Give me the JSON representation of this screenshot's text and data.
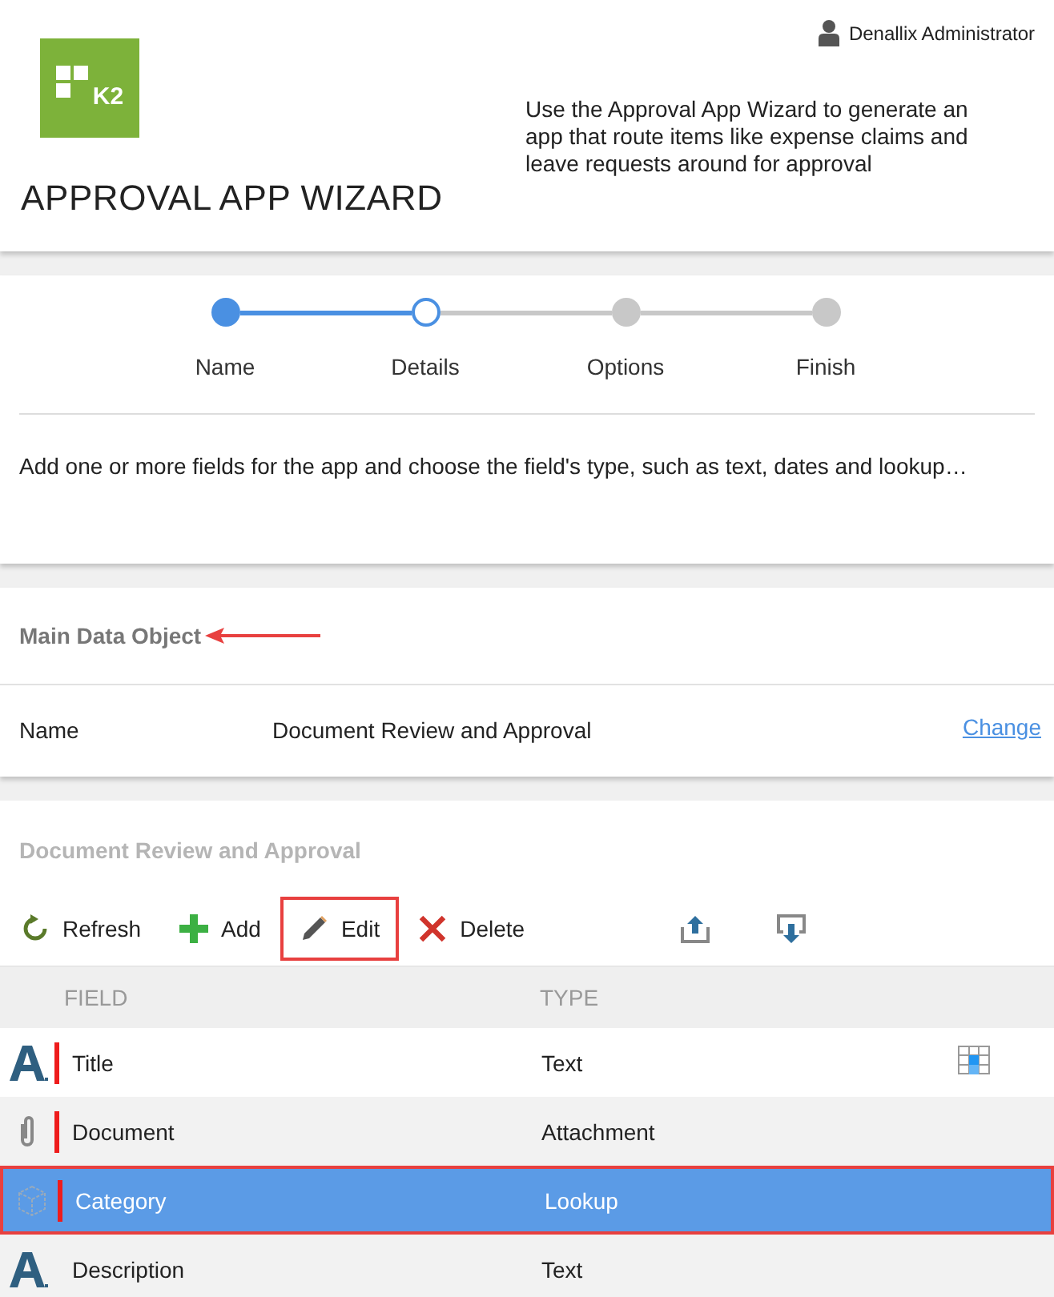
{
  "user": {
    "name": "Denallix Administrator"
  },
  "logo": {
    "text": "K2"
  },
  "title": "APPROVAL APP WIZARD",
  "intro": "Use the Approval App Wizard to generate an app that route items like expense claims and leave requests around for approval",
  "steps": [
    {
      "label": "Name",
      "completed": true,
      "selected": false
    },
    {
      "label": "Details",
      "completed": false,
      "selected": true
    },
    {
      "label": "Options",
      "completed": false,
      "selected": false
    },
    {
      "label": "Finish",
      "completed": false,
      "selected": false
    }
  ],
  "step_description": "Add one or more fields for the app and choose the field's type, such as text, dates and lookup…",
  "main_data_object": {
    "heading": "Main Data Object",
    "arrow": true,
    "name_label": "Name",
    "name_value": "Document Review and Approval",
    "change_link": "Change"
  },
  "fields_panel": {
    "heading": "Document Review and Approval",
    "toolbar": [
      {
        "kind": "refresh",
        "label": "Refresh",
        "highlighted": false
      },
      {
        "kind": "add",
        "label": "Add",
        "highlighted": false
      },
      {
        "kind": "edit",
        "label": "Edit",
        "highlighted": true
      },
      {
        "kind": "delete",
        "label": "Delete",
        "highlighted": false
      },
      {
        "kind": "upload",
        "highlighted": false
      },
      {
        "kind": "download",
        "highlighted": false
      }
    ],
    "columns": [
      "FIELD",
      "TYPE"
    ],
    "rows": [
      {
        "kind": "text",
        "required": true,
        "field": "Title",
        "type": "Text",
        "table_icon": true,
        "selected": false,
        "highlighted": false
      },
      {
        "kind": "attachment",
        "required": true,
        "field": "Document",
        "type": "Attachment",
        "table_icon": false,
        "selected": false,
        "highlighted": false
      },
      {
        "kind": "lookup",
        "required": true,
        "field": "Category",
        "type": "Lookup",
        "table_icon": false,
        "selected": true,
        "highlighted": true
      },
      {
        "kind": "text",
        "required": false,
        "field": "Description",
        "type": "Text",
        "table_icon": false,
        "selected": false,
        "highlighted": false
      }
    ]
  }
}
